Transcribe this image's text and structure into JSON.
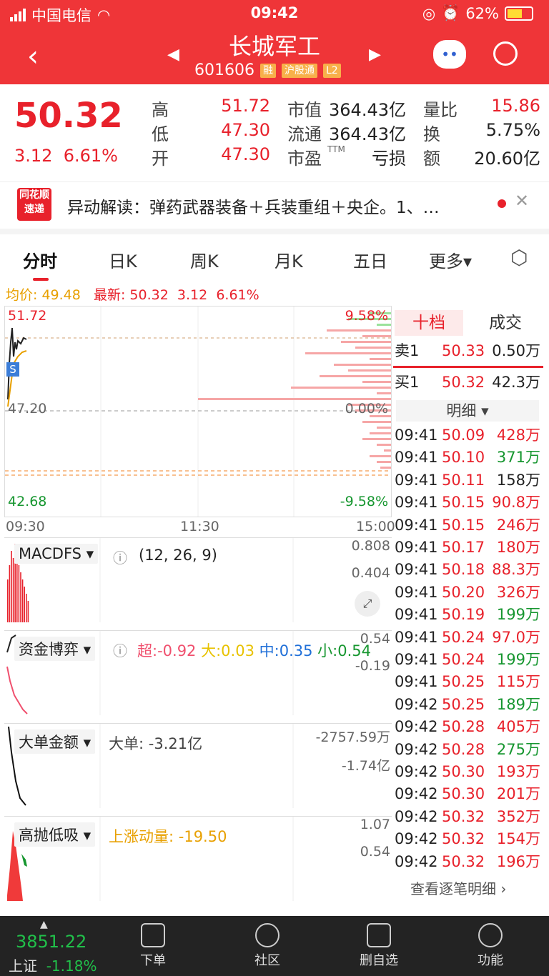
{
  "status": {
    "carrier": "中国电信",
    "time": "09:42",
    "battery": "62%"
  },
  "nav": {
    "title": "长城军工",
    "code": "601606",
    "tags": [
      "融",
      "沪股通",
      "L2"
    ]
  },
  "quote": {
    "price": "50.32",
    "change": "3.12",
    "pct": "6.61%",
    "cells": [
      {
        "k": "高",
        "v": "51.72",
        "vclass": "red"
      },
      {
        "k": "低",
        "v": "47.30",
        "vclass": "red"
      },
      {
        "k": "开",
        "v": "47.30",
        "vclass": "red"
      },
      {
        "k": "市值",
        "v": "364.43亿",
        "vclass": ""
      },
      {
        "k": "流通",
        "v": "364.43亿",
        "vclass": ""
      },
      {
        "k": "市盈",
        "v": "亏损",
        "vclass": ""
      },
      {
        "k": "量比",
        "v": "15.86",
        "vclass": "red"
      },
      {
        "k": "换",
        "v": "5.75%",
        "vclass": ""
      },
      {
        "k": "额",
        "v": "20.60亿",
        "vclass": ""
      }
    ],
    "ttm": "TTM"
  },
  "news": {
    "logo_top": "同花顺",
    "logo_bottom": "速递",
    "text": "异动解读：弹药武器装备＋兵装重组＋央企。1、…"
  },
  "tabs": [
    "分时",
    "日K",
    "周K",
    "月K",
    "五日",
    "更多▾"
  ],
  "info": {
    "avg_label": "均价: 49.48",
    "latest_label": "最新: 50.32",
    "chg": "3.12",
    "pct": "6.61%"
  },
  "chart": {
    "high": "51.72",
    "mid": "47.20",
    "low": "42.68",
    "pct_high": "9.58%",
    "pct_mid": "0.00%",
    "pct_low": "-9.58%",
    "t_open": "09:30",
    "t_mid": "11:30",
    "t_close": "15:00",
    "marker": "S"
  },
  "panels": [
    {
      "name": "MACDFS ▾",
      "extra": "(12, 26, 9)",
      "r1": "0.808",
      "r2": "0.404"
    },
    {
      "name": "资金博弈 ▾",
      "super": "超:-0.92",
      "big": "大:0.03",
      "mid": "中:0.35",
      "small": "小:0.54",
      "r1": "0.54",
      "r2": "-0.19"
    },
    {
      "name": "大单金额 ▾",
      "extra": "大单: -3.21亿",
      "r1": "-2757.59万",
      "r2": "-1.74亿"
    },
    {
      "name": "高抛低吸 ▾",
      "extra": "上涨动量: -19.50",
      "r1": "1.07",
      "r2": "0.54"
    }
  ],
  "rightpanel": {
    "tab1": "十档",
    "tab2": "成交",
    "sell": {
      "label": "卖1",
      "price": "50.33",
      "vol": "0.50万"
    },
    "buy": {
      "label": "买1",
      "price": "50.32",
      "vol": "42.3万"
    },
    "detail": "明细 ▾",
    "trades": [
      [
        "09:41",
        "50.09",
        "428万",
        "red"
      ],
      [
        "09:41",
        "50.10",
        "371万",
        "green"
      ],
      [
        "09:41",
        "50.11",
        "158万",
        "black"
      ],
      [
        "09:41",
        "50.15",
        "90.8万",
        "red"
      ],
      [
        "09:41",
        "50.15",
        "246万",
        "red"
      ],
      [
        "09:41",
        "50.17",
        "180万",
        "red"
      ],
      [
        "09:41",
        "50.18",
        "88.3万",
        "red"
      ],
      [
        "09:41",
        "50.20",
        "326万",
        "red"
      ],
      [
        "09:41",
        "50.19",
        "199万",
        "green"
      ],
      [
        "09:41",
        "50.24",
        "97.0万",
        "red"
      ],
      [
        "09:41",
        "50.24",
        "199万",
        "green"
      ],
      [
        "09:41",
        "50.25",
        "115万",
        "red"
      ],
      [
        "09:42",
        "50.25",
        "189万",
        "green"
      ],
      [
        "09:42",
        "50.28",
        "405万",
        "red"
      ],
      [
        "09:42",
        "50.28",
        "275万",
        "green"
      ],
      [
        "09:42",
        "50.30",
        "193万",
        "red"
      ],
      [
        "09:42",
        "50.30",
        "201万",
        "red"
      ],
      [
        "09:42",
        "50.32",
        "352万",
        "red"
      ],
      [
        "09:42",
        "50.32",
        "154万",
        "red"
      ],
      [
        "09:42",
        "50.32",
        "196万",
        "red"
      ]
    ],
    "more": "查看逐笔明细 ›"
  },
  "bottom": {
    "index_value": "3851.22",
    "index_name": "上证",
    "index_pct": "-1.18%",
    "items": [
      "下单",
      "社区",
      "删自选",
      "功能"
    ]
  }
}
